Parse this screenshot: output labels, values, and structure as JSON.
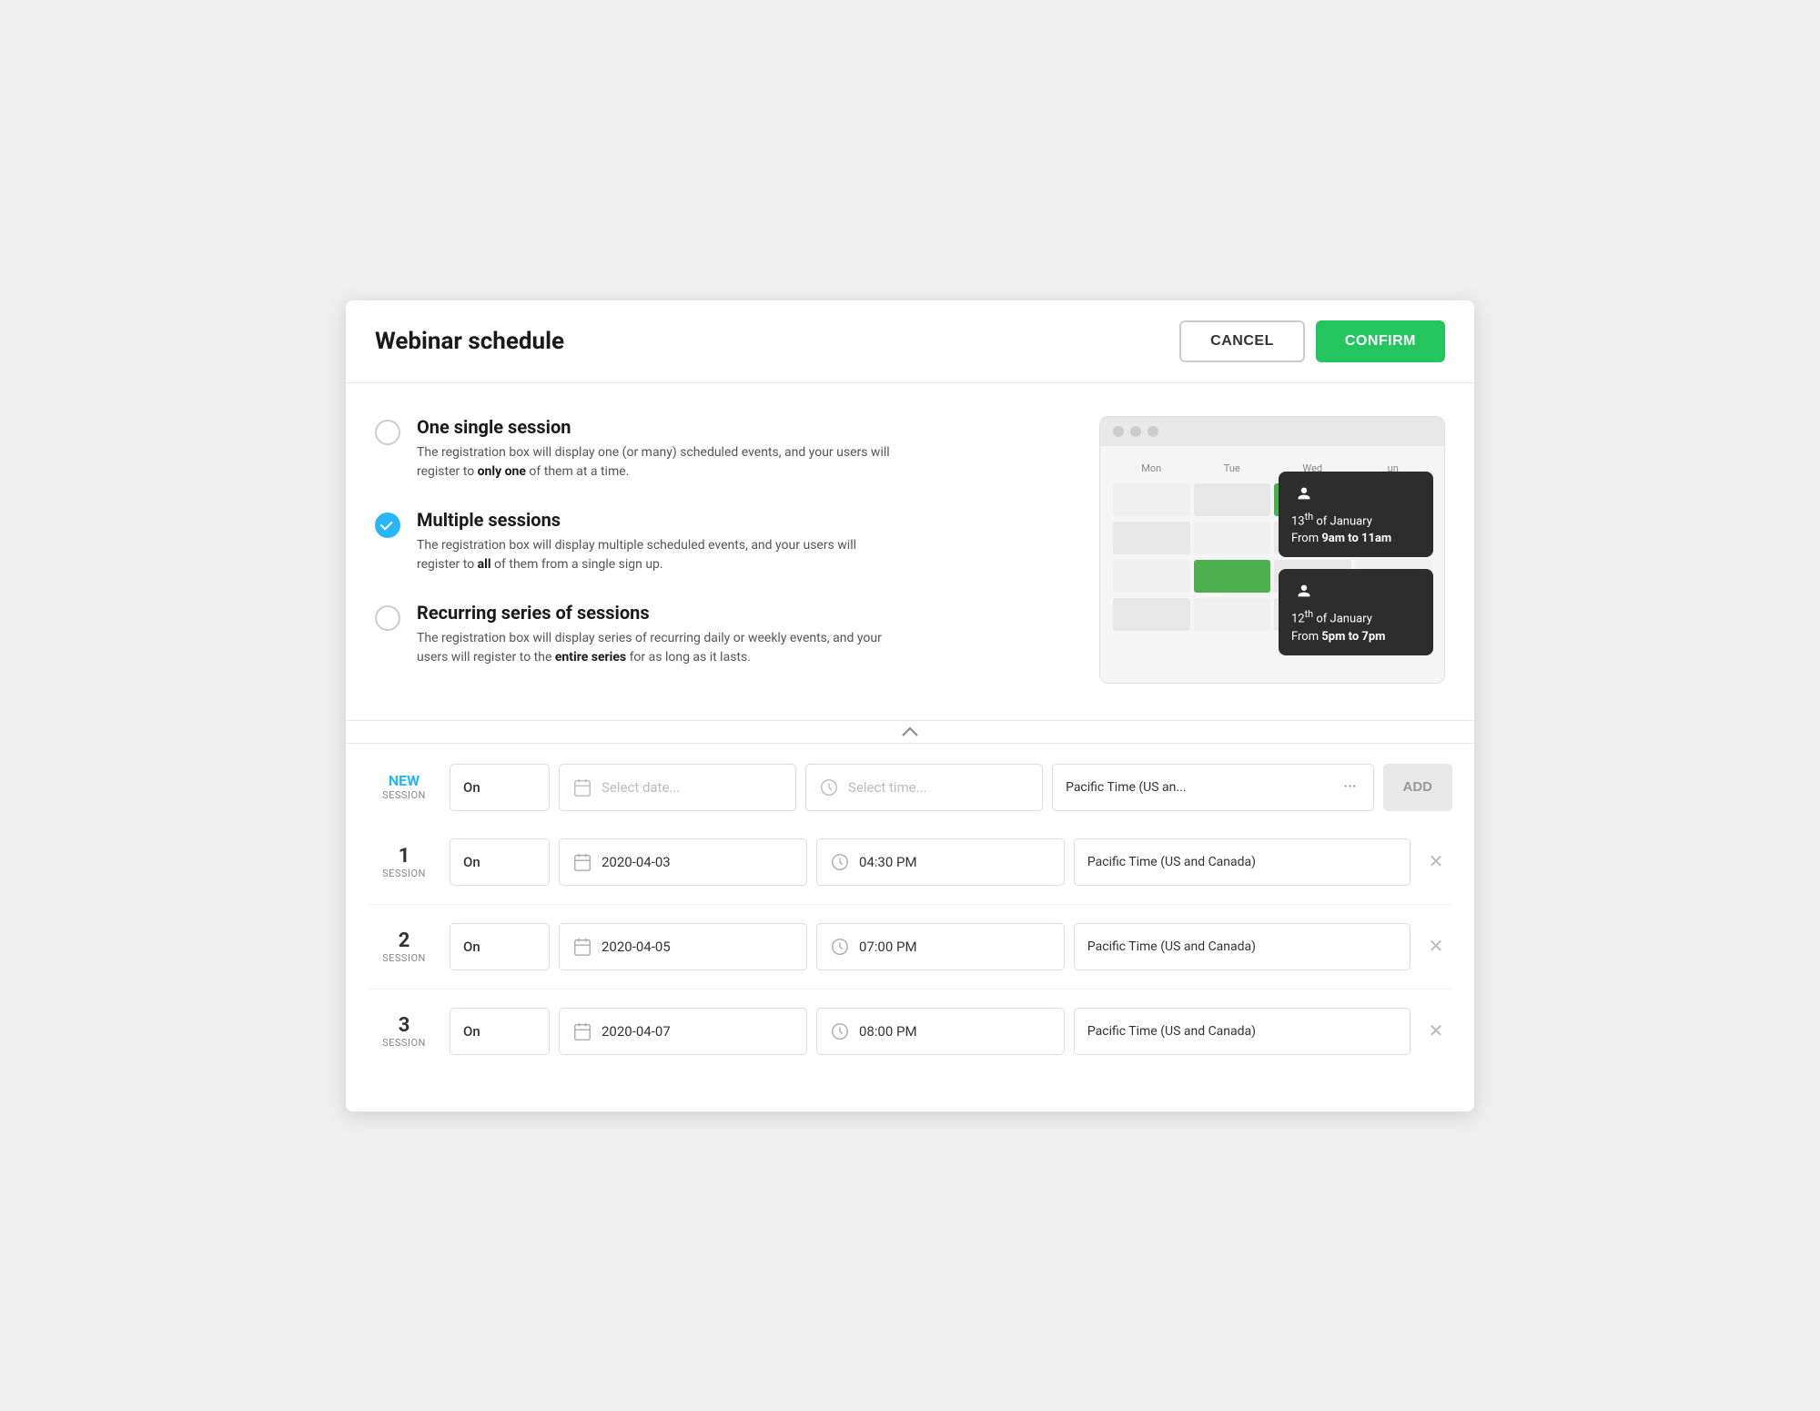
{
  "header": {
    "title": "Webinar schedule",
    "cancel_label": "CANCEL",
    "confirm_label": "CONFIRM"
  },
  "options": [
    {
      "id": "single",
      "label": "One single session",
      "description": "The registration box will display one (or many) scheduled events, and your users will register to ",
      "bold_text": "only one",
      "description_after": " of them at a time.",
      "selected": false
    },
    {
      "id": "multiple",
      "label": "Multiple sessions",
      "description": "The registration box will display multiple scheduled events, and your users will register to ",
      "bold_text": "all",
      "description_after": " of them from a single sign up.",
      "selected": true
    },
    {
      "id": "recurring",
      "label": "Recurring series of sessions",
      "description": "The registration box will display series of recurring daily or weekly events, and your users will register to the ",
      "bold_text": "entire series",
      "description_after": " for as long as it lasts.",
      "selected": false
    }
  ],
  "calendar": {
    "days": [
      "Mon",
      "Tue",
      "Wed",
      "un"
    ],
    "tooltip1": {
      "date": "13",
      "suffix": "th",
      "month": "of January",
      "time": "From ",
      "time_bold": "9am to 11am"
    },
    "tooltip2": {
      "date": "12",
      "suffix": "th",
      "month": "of January",
      "time": "From ",
      "time_bold": "5pm to 7pm"
    }
  },
  "new_session": {
    "label_line1": "NEW",
    "label_line2": "Session",
    "on_value": "On",
    "date_placeholder": "Select date...",
    "time_placeholder": "Select time...",
    "timezone": "Pacific Time (US an...",
    "add_label": "ADD"
  },
  "sessions": [
    {
      "number": "1",
      "sub": "SESSION",
      "on_value": "On",
      "date": "2020-04-03",
      "time": "04:30 PM",
      "timezone": "Pacific Time (US and Canada)"
    },
    {
      "number": "2",
      "sub": "SESSION",
      "on_value": "On",
      "date": "2020-04-05",
      "time": "07:00 PM",
      "timezone": "Pacific Time (US and Canada)"
    },
    {
      "number": "3",
      "sub": "SESSION",
      "on_value": "On",
      "date": "2020-04-07",
      "time": "08:00 PM",
      "timezone": "Pacific Time (US and Canada)"
    }
  ]
}
